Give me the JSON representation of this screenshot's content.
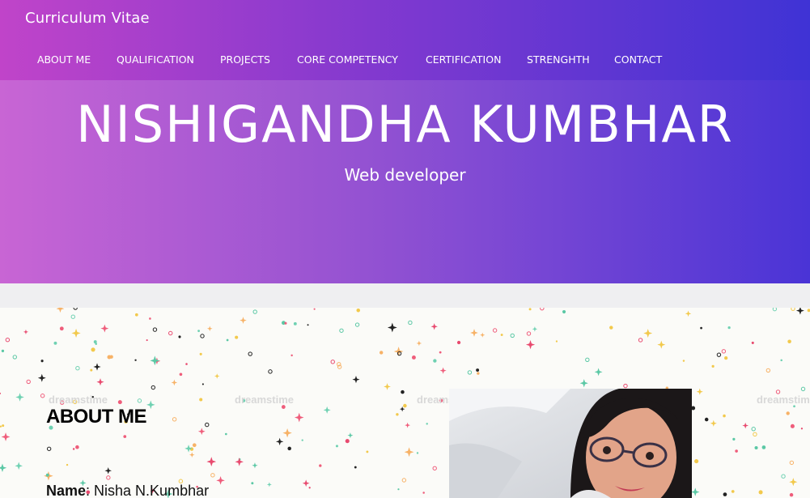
{
  "navbar": {
    "brand": "Curriculum Vitae",
    "items": [
      {
        "label": "ABOUT ME"
      },
      {
        "label": "QUALIFICATION"
      },
      {
        "label": "PROJECTS"
      },
      {
        "label": "CORE COMPETENCY"
      },
      {
        "label": "CERTIFICATION"
      },
      {
        "label": "STRENGHTH"
      },
      {
        "label": "CONTACT"
      }
    ]
  },
  "hero": {
    "name": "NISHIGANDHA KUMBHAR",
    "role": "Web developer"
  },
  "about": {
    "title": "ABOUT ME",
    "name_label": "Name",
    "name_value": ": Nisha N.Kumbhar",
    "watermark": "dreamstime"
  },
  "colors": {
    "gradient_start": "#c865d4",
    "gradient_end": "#4a34d6",
    "nav_start": "#c044c9",
    "nav_end": "#3f33d5"
  }
}
